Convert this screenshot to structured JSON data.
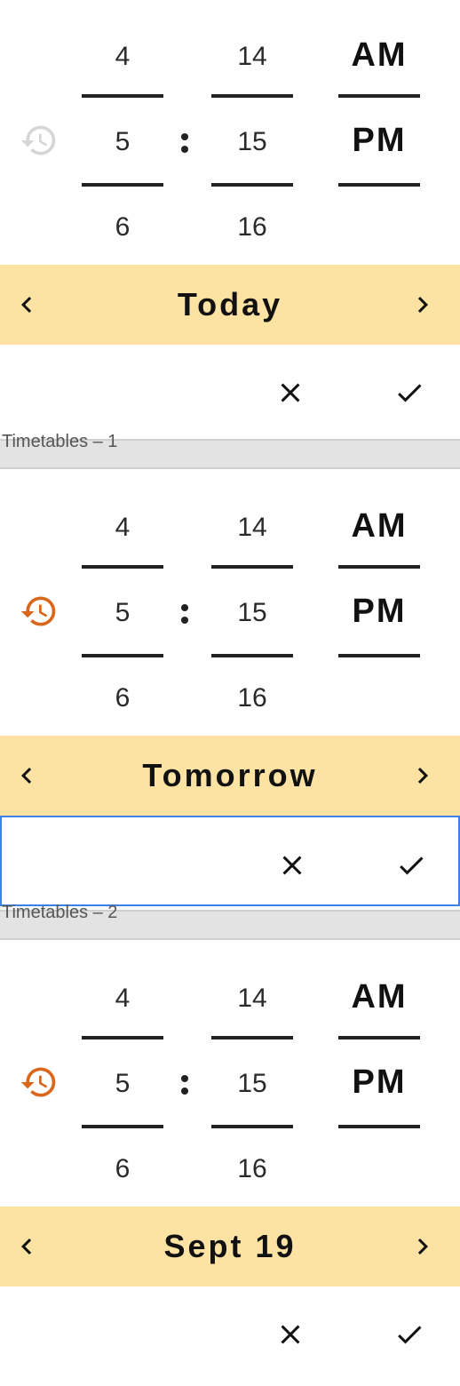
{
  "colors": {
    "date_bar_bg": "#fde3a3",
    "history_inactive": "#d6d6d6",
    "history_active": "#d9661a",
    "focus_border": "#3b82e6",
    "separator": "#e3e3e3"
  },
  "icons": {
    "history": "history-icon",
    "prev": "chevron-left-icon",
    "next": "chevron-right-icon",
    "cancel": "close-icon",
    "confirm": "check-icon"
  },
  "panels": [
    {
      "history_active": false,
      "hours": {
        "above": "4",
        "selected": "5",
        "below": "6"
      },
      "minutes": {
        "above": "14",
        "selected": "15",
        "below": "16"
      },
      "ampm": {
        "above": "AM",
        "selected": "PM"
      },
      "date_label": "Today",
      "actions_focused": false
    },
    {
      "history_active": true,
      "hours": {
        "above": "4",
        "selected": "5",
        "below": "6"
      },
      "minutes": {
        "above": "14",
        "selected": "15",
        "below": "16"
      },
      "ampm": {
        "above": "AM",
        "selected": "PM"
      },
      "date_label": "Tomorrow",
      "actions_focused": true
    },
    {
      "history_active": true,
      "hours": {
        "above": "4",
        "selected": "5",
        "below": "6"
      },
      "minutes": {
        "above": "14",
        "selected": "15",
        "below": "16"
      },
      "ampm": {
        "above": "AM",
        "selected": "PM"
      },
      "date_label": "Sept 19",
      "actions_focused": false
    }
  ],
  "separators": [
    "Timetables – 1",
    "Timetables – 2"
  ]
}
